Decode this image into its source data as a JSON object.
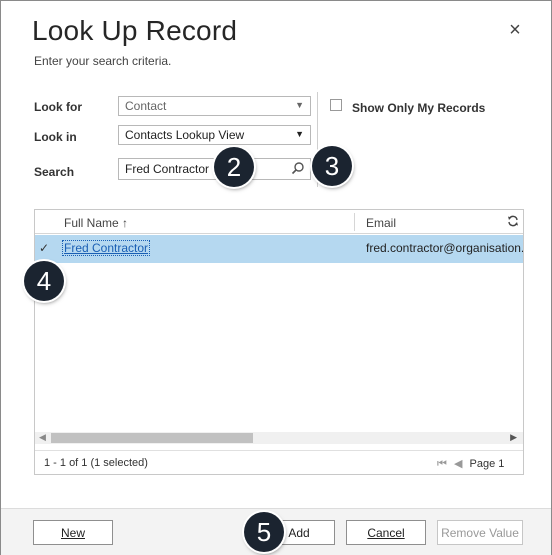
{
  "dialog": {
    "title": "Look Up Record",
    "subtitle": "Enter your search criteria.",
    "close_glyph": "×"
  },
  "form": {
    "look_for_label": "Look for",
    "look_for_value": "Contact",
    "look_in_label": "Look in",
    "look_in_value": "Contacts Lookup View",
    "search_label": "Search",
    "search_value": "Fred Contractor",
    "show_only_my_records": "Show Only My Records",
    "show_only_my_records_checked": false
  },
  "callouts": [
    "2",
    "3",
    "4",
    "5"
  ],
  "grid": {
    "columns": [
      "Full Name ↑",
      "Email"
    ],
    "rows": [
      {
        "selected": true,
        "full_name": "Fred Contractor",
        "email": "fred.contractor@organisation.co"
      }
    ],
    "status": "1 - 1 of 1 (1 selected)",
    "pager": {
      "first": "⏮",
      "prev": "◀",
      "label": "Page 1",
      "next": "▶"
    }
  },
  "buttons": {
    "new": "New",
    "add": "Add",
    "cancel": "Cancel",
    "remove_value": "Remove Value"
  },
  "icons": {
    "close": "close-icon",
    "dropdown": "chevron-down-icon",
    "search": "search-icon",
    "refresh": "refresh-icon",
    "check": "checkmark-icon"
  }
}
